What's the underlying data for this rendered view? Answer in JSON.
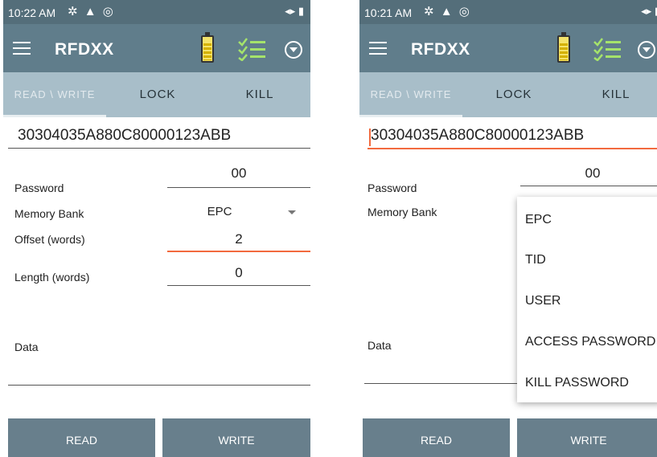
{
  "colors": {
    "statusbar": "#546e7a",
    "toolbar": "#607d8b",
    "tabs": "#a8bec9",
    "accent": "#f26a3e",
    "button": "#687f8c"
  },
  "left": {
    "status": {
      "time": "10:22 AM",
      "icons": "✲ ▲ ◎",
      "right": "◂▸ ▮"
    },
    "toolbar": {
      "title": "RFDXX",
      "battery_icon": "battery-icon",
      "inventory_icon": "checklist-icon",
      "menu_icon": "dropdown-circle-icon"
    },
    "tabs": [
      "READ \\ WRITE",
      "LOCK",
      "KILL"
    ],
    "tag_id": "30304035A880C80000123ABB",
    "password_label": "Password",
    "password_value": "00",
    "memory_bank_label": "Memory Bank",
    "memory_bank_value": "EPC",
    "offset_label": "Offset (words)",
    "offset_value": "2",
    "length_label": "Length (words)",
    "length_value": "0",
    "data_label": "Data",
    "read_label": "READ",
    "write_label": "WRITE"
  },
  "right": {
    "status": {
      "time": "10:21 AM",
      "icons": "✲ ▲ ◎",
      "right": "◂▸ ▮"
    },
    "toolbar": {
      "title": "RFDXX"
    },
    "tabs": [
      "READ \\ WRITE",
      "LOCK",
      "KILL"
    ],
    "tag_id": "30304035A880C80000123ABB",
    "password_label": "Password",
    "password_value": "00",
    "memory_bank_label": "Memory Bank",
    "data_label": "Data",
    "read_label": "READ",
    "write_label": "WRITE",
    "memory_options": [
      "EPC",
      "TID",
      "USER",
      "ACCESS PASSWORD",
      "KILL PASSWORD"
    ]
  }
}
